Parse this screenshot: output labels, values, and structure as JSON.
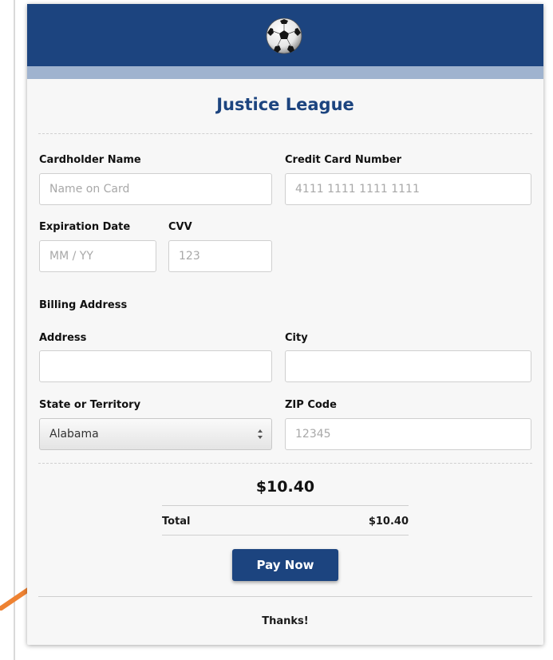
{
  "header": {
    "logo_icon": "soccer-ball-icon",
    "colors": {
      "primary": "#1c447f",
      "band": "#9fb3cf",
      "card_bg": "#f7f7f7",
      "annotation_arrow": "#ee8232"
    }
  },
  "form": {
    "title": "Justice League",
    "cardholder_name": {
      "label": "Cardholder Name",
      "placeholder": "Name on Card",
      "value": ""
    },
    "card_number": {
      "label": "Credit Card Number",
      "placeholder": "4111 1111 1111 1111",
      "value": ""
    },
    "expiration": {
      "label": "Expiration Date",
      "placeholder": "MM / YY",
      "value": ""
    },
    "cvv": {
      "label": "CVV",
      "placeholder": "123",
      "value": ""
    },
    "billing_heading": "Billing Address",
    "address": {
      "label": "Address",
      "placeholder": "",
      "value": ""
    },
    "city": {
      "label": "City",
      "placeholder": "",
      "value": ""
    },
    "state": {
      "label": "State or Territory",
      "selected": "Alabama"
    },
    "zip": {
      "label": "ZIP Code",
      "placeholder": "12345",
      "value": ""
    }
  },
  "summary": {
    "amount": "$10.40",
    "total_label": "Total",
    "total_value": "$10.40"
  },
  "actions": {
    "pay_label": "Pay Now"
  },
  "footer": {
    "thanks": "Thanks!"
  }
}
